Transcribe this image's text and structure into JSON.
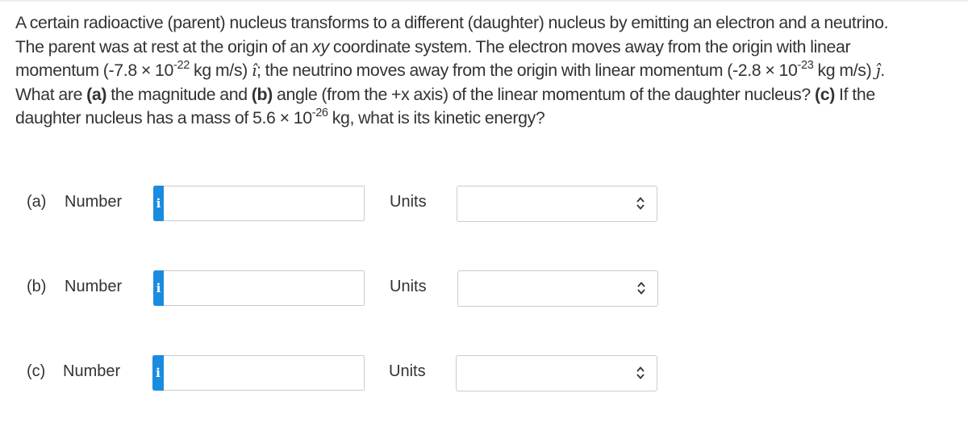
{
  "question": {
    "line1": "A certain radioactive (parent) nucleus transforms to a different (daughter) nucleus by emitting an electron and a neutrino.",
    "line2_pre": "The parent was at rest at the origin of an ",
    "line2_var": "xy",
    "line2_post": " coordinate system. The electron moves away from the origin with linear",
    "line3_a": "momentum (-7.8 × 10",
    "line3_exp1": "-22",
    "line3_b": " kg m/s) ",
    "unit_i": "î",
    "line3_c": "; the neutrino moves away from the origin with linear momentum (-2.8 × 10",
    "line3_exp2": "-23",
    "line3_d": " kg m/s) ",
    "unit_j": "ĵ",
    "line3_e": ".",
    "line4_a": "What are ",
    "part_a_tag": "(a)",
    "line4_b": " the magnitude and ",
    "part_b_tag": "(b)",
    "line4_c": " angle (from the +x axis) of the linear momentum of the daughter nucleus? ",
    "part_c_tag": "(c)",
    "line4_d": " If the",
    "line5_a": "daughter nucleus has a mass of 5.6 × 10",
    "line5_exp": "-26",
    "line5_b": " kg, what is its kinetic energy?"
  },
  "answers": [
    {
      "part": "(a)",
      "number_label": "Number",
      "info_icon": "i",
      "number_value": "",
      "units_label": "Units",
      "units_selected": ""
    },
    {
      "part": "(b)",
      "number_label": "Number",
      "info_icon": "i",
      "number_value": "",
      "units_label": "Units",
      "units_selected": ""
    },
    {
      "part": "(c)",
      "number_label": "Number",
      "info_icon": "i",
      "number_value": "",
      "units_label": "Units",
      "units_selected": ""
    }
  ],
  "colors": {
    "info_button": "#1a8ce0",
    "text": "#333333",
    "border": "#cccccc"
  }
}
